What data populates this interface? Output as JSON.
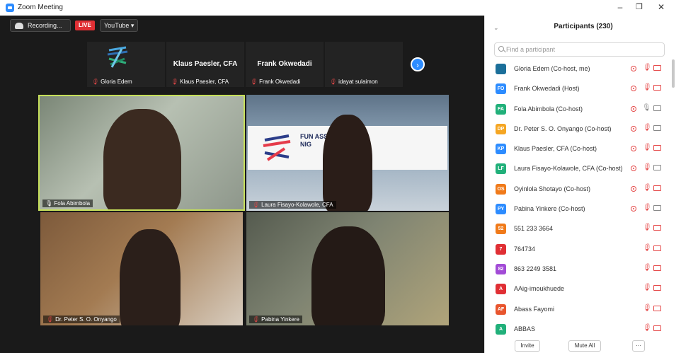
{
  "window": {
    "title": "Zoom Meeting",
    "minimize": "–",
    "maximize": "❐",
    "close": "✕"
  },
  "toolbar": {
    "recording_label": "Recording...",
    "live_badge": "LIVE",
    "stream_label": "YouTube ▾"
  },
  "strip": [
    {
      "big": "",
      "small": "Gloria Edem"
    },
    {
      "big": "Klaus Paesler, CFA",
      "small": "Klaus Paesler, CFA"
    },
    {
      "big": "Frank Okwedadi",
      "small": "Frank Okwedadi"
    },
    {
      "big": "",
      "small": "idayat sulaimon"
    }
  ],
  "tiles": [
    {
      "name": "Fola Abimbola"
    },
    {
      "name": "Laura Fisayo-Kolawole, CFA"
    },
    {
      "name": "Dr. Peter S. O. Onyango"
    },
    {
      "name": "Pabina Yinkere"
    }
  ],
  "banner": {
    "text": "FUN ASS NIG"
  },
  "panel": {
    "title": "Participants (230)",
    "search_placeholder": "Find a participant",
    "participants": [
      {
        "initials": "",
        "name": "Gloria Edem (Co-host, me)",
        "color": "#1b6f9a",
        "video": true,
        "mic_on": false,
        "cam_on": false
      },
      {
        "initials": "FO",
        "name": "Frank Okwedadi (Host)",
        "color": "#2d8cff",
        "video": true,
        "mic_on": false,
        "cam_on": false
      },
      {
        "initials": "FA",
        "name": "Fola Abimbola (Co-host)",
        "color": "#21b07a",
        "video": true,
        "mic_on": true,
        "cam_on": true
      },
      {
        "initials": "DP",
        "name": "Dr. Peter S. O. Onyango (Co-host)",
        "color": "#f5a623",
        "video": true,
        "mic_on": false,
        "cam_on": true
      },
      {
        "initials": "KP",
        "name": "Klaus Paesler, CFA (Co-host)",
        "color": "#2d8cff",
        "video": true,
        "mic_on": false,
        "cam_on": false
      },
      {
        "initials": "LF",
        "name": "Laura Fisayo-Kolawole, CFA (Co-host)",
        "color": "#21b07a",
        "video": true,
        "mic_on": false,
        "cam_on": true
      },
      {
        "initials": "OS",
        "name": "Oyinlola Shotayo (Co-host)",
        "color": "#f07a1a",
        "video": true,
        "mic_on": false,
        "cam_on": false
      },
      {
        "initials": "PY",
        "name": "Pabina Yinkere (Co-host)",
        "color": "#2d8cff",
        "video": true,
        "mic_on": false,
        "cam_on": true
      },
      {
        "initials": "52",
        "name": "551 233 3664",
        "color": "#f07a1a",
        "video": false,
        "mic_on": false,
        "cam_on": false
      },
      {
        "initials": "7",
        "name": "764734",
        "color": "#e02f34",
        "video": false,
        "mic_on": false,
        "cam_on": false
      },
      {
        "initials": "82",
        "name": "863 2249 3581",
        "color": "#a24bd6",
        "video": false,
        "mic_on": false,
        "cam_on": false
      },
      {
        "initials": "A",
        "name": "AAig-imoukhuede",
        "color": "#e02f34",
        "video": false,
        "mic_on": false,
        "cam_on": false
      },
      {
        "initials": "AF",
        "name": "Abass Fayomi",
        "color": "#e8552e",
        "video": false,
        "mic_on": false,
        "cam_on": false
      },
      {
        "initials": "A",
        "name": "ABBAS",
        "color": "#21b07a",
        "video": false,
        "mic_on": false,
        "cam_on": false
      }
    ],
    "invite_label": "Invite",
    "mute_all_label": "Mute All",
    "more_label": "···"
  }
}
